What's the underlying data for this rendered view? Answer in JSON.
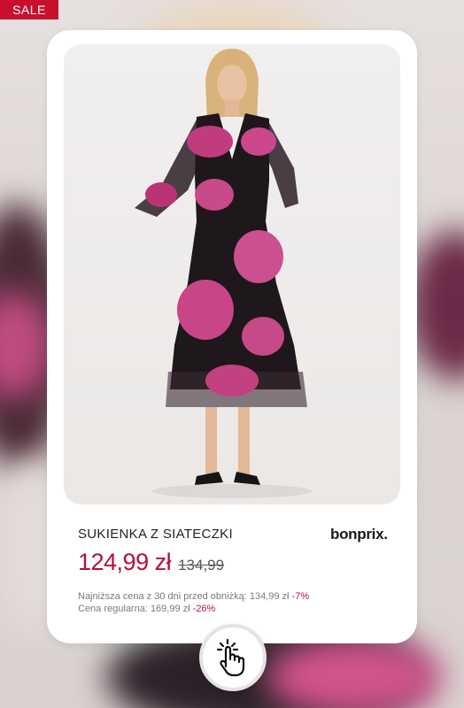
{
  "badge": {
    "label": "SALE"
  },
  "product": {
    "title": "SUKIENKA Z SIATECZKI",
    "brand": "bonprix.",
    "price_current": "124,99 zł",
    "price_old": "134,99",
    "lowest_price_label": "Najniższa cena z 30 dni przed obniżką: 134,99 zł",
    "lowest_price_pct": "-7%",
    "regular_price_label": "Cena regularna: 169,99 zł",
    "regular_price_pct": "-26%"
  },
  "icons": {
    "tap": "hand-tap-icon"
  },
  "colors": {
    "accent": "#b3123a",
    "badge": "#c8102e"
  }
}
